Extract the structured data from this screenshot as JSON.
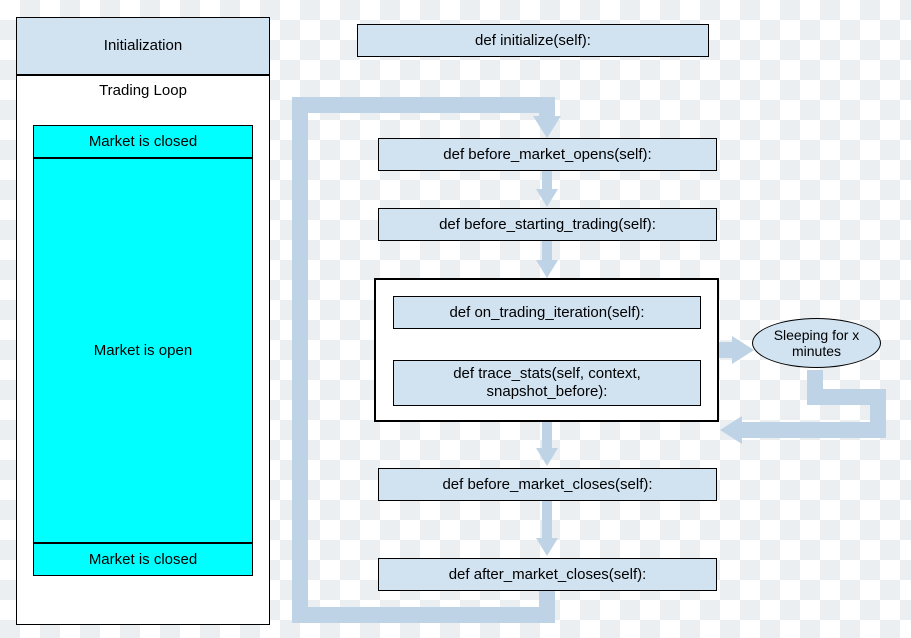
{
  "diagram": {
    "left": {
      "initialization": "Initialization",
      "trading_loop": "Trading Loop",
      "market_closed_top": "Market is closed",
      "market_open": "Market is open",
      "market_closed_bottom": "Market is closed"
    },
    "right": {
      "initialize": "def initialize(self):",
      "before_market_opens": "def before_market_opens(self):",
      "before_starting_trading": "def before_starting_trading(self):",
      "on_trading_iteration": "def on_trading_iteration(self):",
      "trace_stats": "def trace_stats(self, context, snapshot_before):",
      "before_market_closes": "def before_market_closes(self):",
      "after_market_closes": "def after_market_closes(self):"
    },
    "annotations": {
      "sleeping": "Sleeping for x minutes"
    },
    "colors": {
      "pale_blue": "#d1e2f1",
      "cyan": "#00ffff",
      "arrow": "#bed3e6"
    },
    "flow_order": [
      "initialize",
      "before_market_opens",
      "before_starting_trading",
      "on_trading_iteration",
      "trace_stats",
      "before_market_closes",
      "after_market_closes"
    ],
    "loops": [
      {
        "from": "trace_stats",
        "to": "on_trading_iteration",
        "via": "sleeping",
        "label": "inner trading iteration loop"
      },
      {
        "from": "after_market_closes",
        "to": "before_market_opens",
        "label": "outer trading-day loop"
      }
    ]
  }
}
